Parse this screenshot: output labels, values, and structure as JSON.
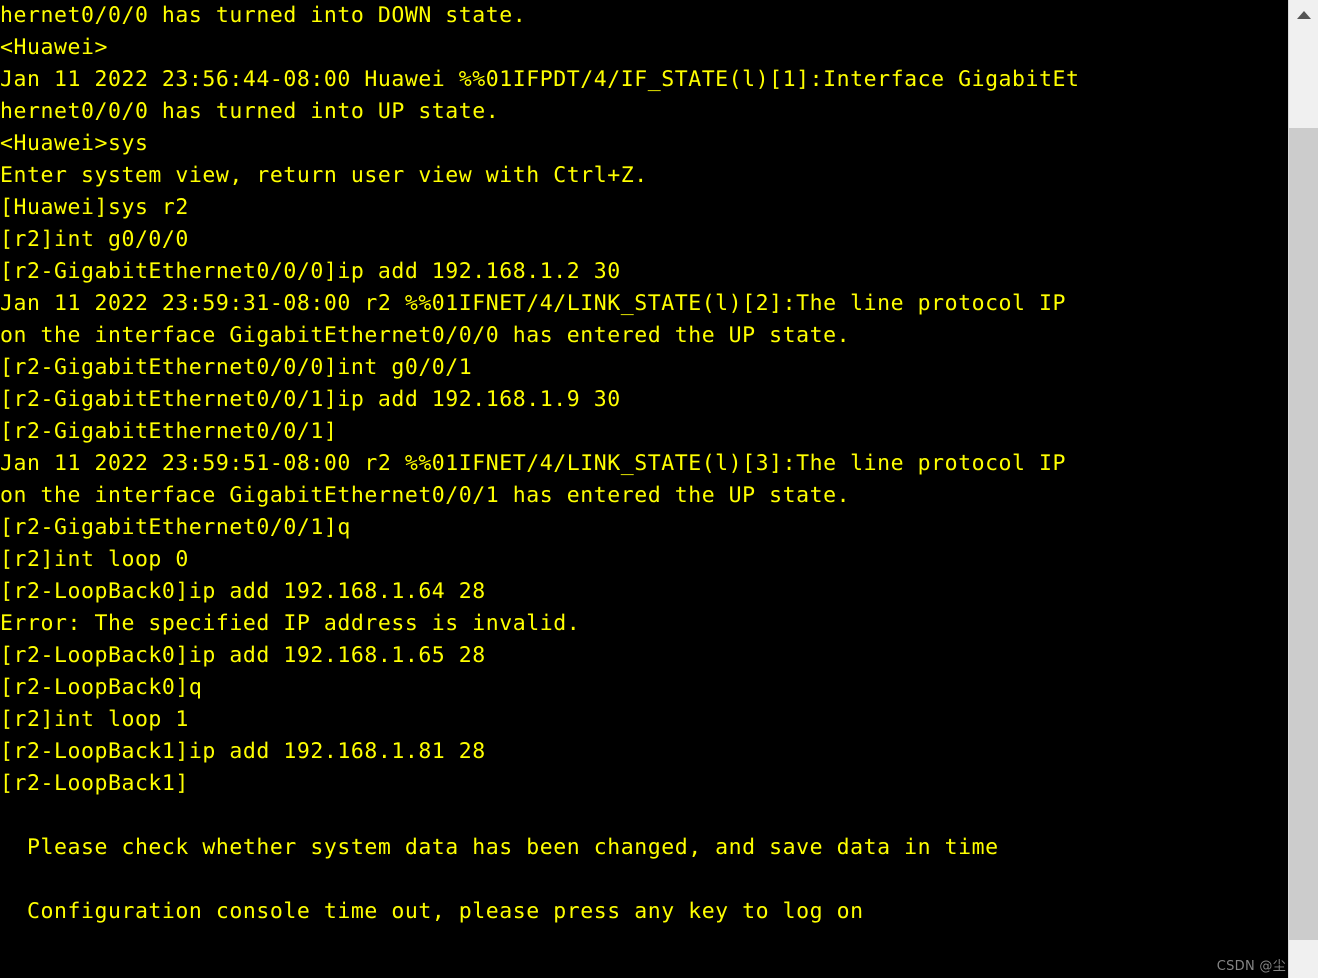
{
  "terminal": {
    "background_color": "#000000",
    "text_color": "#ffff00",
    "lines": [
      "hernet0/0/0 has turned into DOWN state.",
      "<Huawei>",
      "Jan 11 2022 23:56:44-08:00 Huawei %%01IFPDT/4/IF_STATE(l)[1]:Interface GigabitEt",
      "hernet0/0/0 has turned into UP state.",
      "<Huawei>sys",
      "Enter system view, return user view with Ctrl+Z.",
      "[Huawei]sys r2",
      "[r2]int g0/0/0",
      "[r2-GigabitEthernet0/0/0]ip add 192.168.1.2 30",
      "Jan 11 2022 23:59:31-08:00 r2 %%01IFNET/4/LINK_STATE(l)[2]:The line protocol IP",
      "on the interface GigabitEthernet0/0/0 has entered the UP state.",
      "[r2-GigabitEthernet0/0/0]int g0/0/1",
      "[r2-GigabitEthernet0/0/1]ip add 192.168.1.9 30",
      "[r2-GigabitEthernet0/0/1]",
      "Jan 11 2022 23:59:51-08:00 r2 %%01IFNET/4/LINK_STATE(l)[3]:The line protocol IP",
      "on the interface GigabitEthernet0/0/1 has entered the UP state.",
      "[r2-GigabitEthernet0/0/1]q",
      "[r2]int loop 0",
      "[r2-LoopBack0]ip add 192.168.1.64 28",
      "Error: The specified IP address is invalid.",
      "[r2-LoopBack0]ip add 192.168.1.65 28",
      "[r2-LoopBack0]q",
      "[r2]int loop 1",
      "[r2-LoopBack1]ip add 192.168.1.81 28",
      "[r2-LoopBack1]",
      "",
      "  Please check whether system data has been changed, and save data in time",
      "",
      "  Configuration console time out, please press any key to log on"
    ]
  },
  "scrollbar": {
    "up_arrow_icon": "chevron-up-icon",
    "track_color": "#f0f0f0",
    "thumb_color": "#cccccc"
  },
  "watermark": {
    "text": "CSDN @尘"
  }
}
